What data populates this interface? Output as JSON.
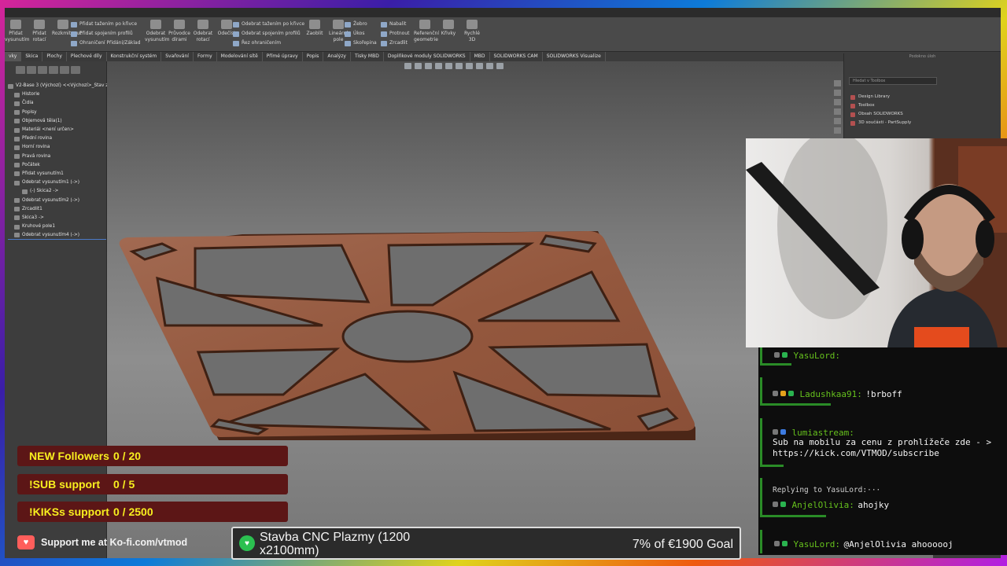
{
  "ribbon": {
    "groups": [
      {
        "big": [
          "Přidat vysunutím",
          "Přidat rotací",
          "Rozkmitnout"
        ]
      },
      {
        "rows": [
          "Přidat tažením po křivce",
          "Přidat spojením profilů",
          "Ohraničení Přidání/Základ"
        ]
      },
      {
        "big": [
          "Odebrat vysunutím",
          "Průvodce dírami",
          "Odebrat rotací",
          "Odečíst"
        ]
      },
      {
        "rows": [
          "Odebrat tažením po křivce",
          "Odebrat spojením profilů",
          "Řez ohraničením"
        ]
      },
      {
        "big": [
          "Zaoblit",
          "Lineární pole"
        ]
      },
      {
        "rows": [
          "Žebro",
          "Úkos",
          "Skořepina"
        ]
      },
      {
        "rows": [
          "Nabalit",
          "Protnout",
          "Zrcadlit"
        ]
      },
      {
        "big": [
          "Referenční geometrie",
          "Křivky",
          "Rychlé 3D"
        ]
      }
    ]
  },
  "command_tabs": [
    "vky",
    "Skica",
    "Plochy",
    "Plechové díly",
    "Konstrukční systém",
    "Svařování",
    "Formy",
    "Modelování sítě",
    "Přímé úpravy",
    "Popis",
    "Analýzy",
    "Tisky MBD",
    "Doplňkové moduly SOLIDWORKS",
    "MBD",
    "SOLIDWORKS CAM",
    "SOLIDWORKS Visualize"
  ],
  "feature_tree": {
    "root": "V2-Base 3 (Výchozí) <<Výchozí>_Stav ze",
    "items": [
      {
        "label": "Historie",
        "level": 1
      },
      {
        "label": "Čidla",
        "level": 1
      },
      {
        "label": "Popisy",
        "level": 1
      },
      {
        "label": "Objemová těla(1)",
        "level": 1
      },
      {
        "label": "Materiál <není určen>",
        "level": 1
      },
      {
        "label": "Přední rovina",
        "level": 1
      },
      {
        "label": "Horní rovina",
        "level": 1
      },
      {
        "label": "Pravá rovina",
        "level": 1
      },
      {
        "label": "Počátek",
        "level": 1
      },
      {
        "label": "Přidat vysunutím1",
        "level": 1
      },
      {
        "label": "Odebrat vysunutím1 (->)",
        "level": 1
      },
      {
        "label": "(-) Skica2 ->",
        "level": 2
      },
      {
        "label": "Odebrat vysunutím2 (->)",
        "level": 1
      },
      {
        "label": "Zrcadlit1",
        "level": 1
      },
      {
        "label": "Skica3 ->",
        "level": 1
      },
      {
        "label": "Kruhové pole1",
        "level": 1
      },
      {
        "label": "Odebrat vysunutím4 (->)",
        "level": 1
      }
    ]
  },
  "task_pane": {
    "title": "Podokno úloh",
    "search_placeholder": "Hledat v Toolbox",
    "items": [
      "Design Library",
      "Toolbox",
      "Obsah SOLIDWORKS",
      "3D součásti - PartSupply"
    ]
  },
  "chat": {
    "messages": [
      {
        "user": "YasuLord:",
        "text": "",
        "partial": true
      },
      {
        "user": "Ladushkaa91:",
        "text": "!brboff"
      },
      {
        "user": "lumiastream:",
        "text": "Sub na mobilu za cenu z prohlížeče zde - > https://kick.com/VTMOD/subscribe"
      },
      {
        "reply": "Replying to YasuLord:···",
        "user": "AnjelOlivia:",
        "text": "ahojky"
      },
      {
        "user": "YasuLord:",
        "text": "@AnjelOlivia ahoooooj"
      }
    ],
    "accent": "#66c11d"
  },
  "goals": [
    {
      "label": "NEW Followers",
      "value": "0 / 20"
    },
    {
      "label": "!SUB support",
      "value": "0 / 5"
    },
    {
      "label": "!KIKSs support",
      "value": "0 / 2500"
    }
  ],
  "kofi": {
    "text": "Support me at Ko-fi.com/vtmod",
    "icon": "kofi-heart-icon"
  },
  "donation": {
    "title": "Stavba CNC Plazmy (1200 x2100mm)",
    "progress_text": "7% of €1900 Goal",
    "percent": 7
  },
  "colors": {
    "goal_text": "#f8ef1f",
    "goal_bg": "#5c1616",
    "wood": "#9a5e44"
  }
}
